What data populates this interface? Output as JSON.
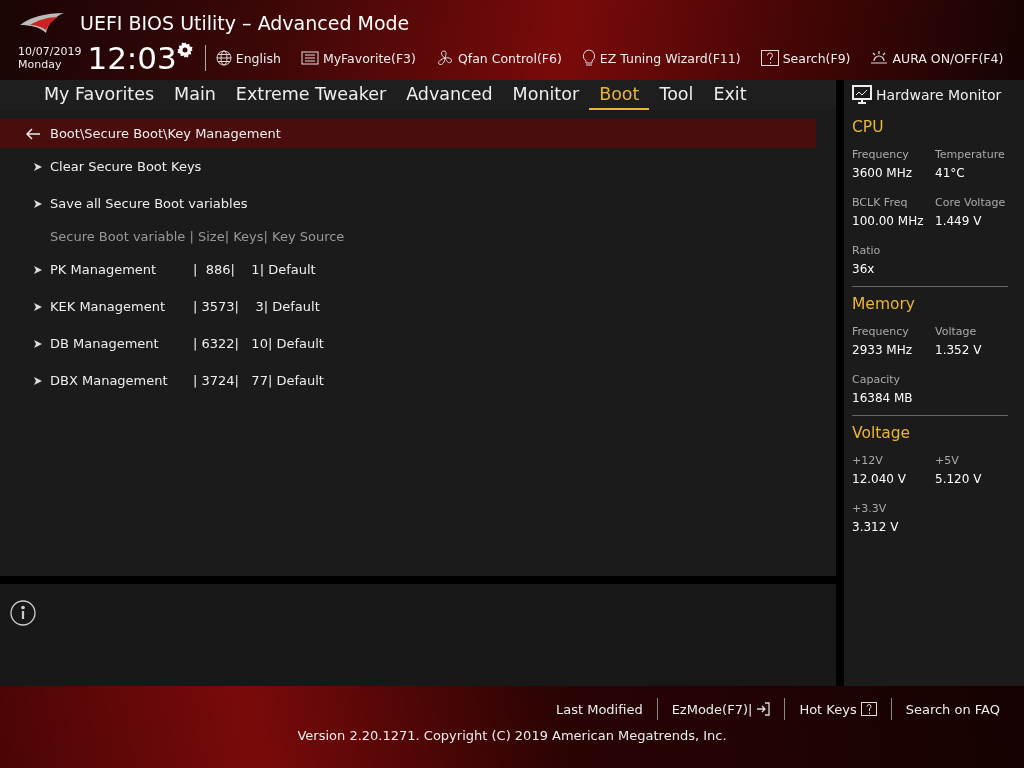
{
  "window": {
    "title": "UEFI BIOS Utility – Advanced Mode"
  },
  "clock": {
    "date": "10/07/2019",
    "day": "Monday",
    "time": "12:03"
  },
  "toolbar": [
    "English",
    "MyFavorite(F3)",
    "Qfan Control(F6)",
    "EZ Tuning Wizard(F11)",
    "Search(F9)",
    "AURA ON/OFF(F4)"
  ],
  "tabs": [
    {
      "label": "My Favorites",
      "selected": false
    },
    {
      "label": "Main",
      "selected": false
    },
    {
      "label": "Extreme Tweaker",
      "selected": false
    },
    {
      "label": "Advanced",
      "selected": false
    },
    {
      "label": "Monitor",
      "selected": false
    },
    {
      "label": "Boot",
      "selected": true
    },
    {
      "label": "Tool",
      "selected": false
    },
    {
      "label": "Exit",
      "selected": false
    }
  ],
  "breadcrumb": "Boot\\Secure Boot\\Key Management",
  "items": [
    {
      "kind": "submenu",
      "label": "Clear Secure Boot Keys"
    },
    {
      "kind": "submenu",
      "label": "Save all Secure Boot variables"
    },
    {
      "kind": "header",
      "label": "Secure Boot variable | Size| Keys| Key Source"
    },
    {
      "kind": "submenu",
      "label": "PK Management",
      "value": "|  886|    1| Default"
    },
    {
      "kind": "submenu",
      "label": "KEK Management",
      "value": "| 3573|    3| Default"
    },
    {
      "kind": "submenu",
      "label": "DB Management",
      "value": "| 6322|   10| Default"
    },
    {
      "kind": "submenu",
      "label": "DBX Management",
      "value": "| 3724|   77| Default"
    }
  ],
  "hardware_monitor": {
    "title": "Hardware Monitor",
    "sections": [
      {
        "title": "CPU",
        "stats": [
          {
            "label": "Frequency",
            "value": "3600 MHz"
          },
          {
            "label": "Temperature",
            "value": "41°C"
          },
          {
            "label": "BCLK Freq",
            "value": "100.00 MHz"
          },
          {
            "label": "Core Voltage",
            "value": "1.449 V"
          },
          {
            "label": "Ratio",
            "value": "36x"
          }
        ]
      },
      {
        "title": "Memory",
        "stats": [
          {
            "label": "Frequency",
            "value": "2933 MHz"
          },
          {
            "label": "Voltage",
            "value": "1.352 V"
          },
          {
            "label": "Capacity",
            "value": "16384 MB"
          }
        ]
      },
      {
        "title": "Voltage",
        "stats": [
          {
            "label": "+12V",
            "value": "12.040 V"
          },
          {
            "label": "+5V",
            "value": "5.120 V"
          },
          {
            "label": "+3.3V",
            "value": "3.312 V"
          }
        ]
      }
    ]
  },
  "footer": {
    "links": [
      "Last Modified",
      "EzMode(F7)|",
      "Hot Keys",
      "Search on FAQ"
    ],
    "version": "Version 2.20.1271. Copyright (C) 2019 American Megatrends, Inc."
  }
}
